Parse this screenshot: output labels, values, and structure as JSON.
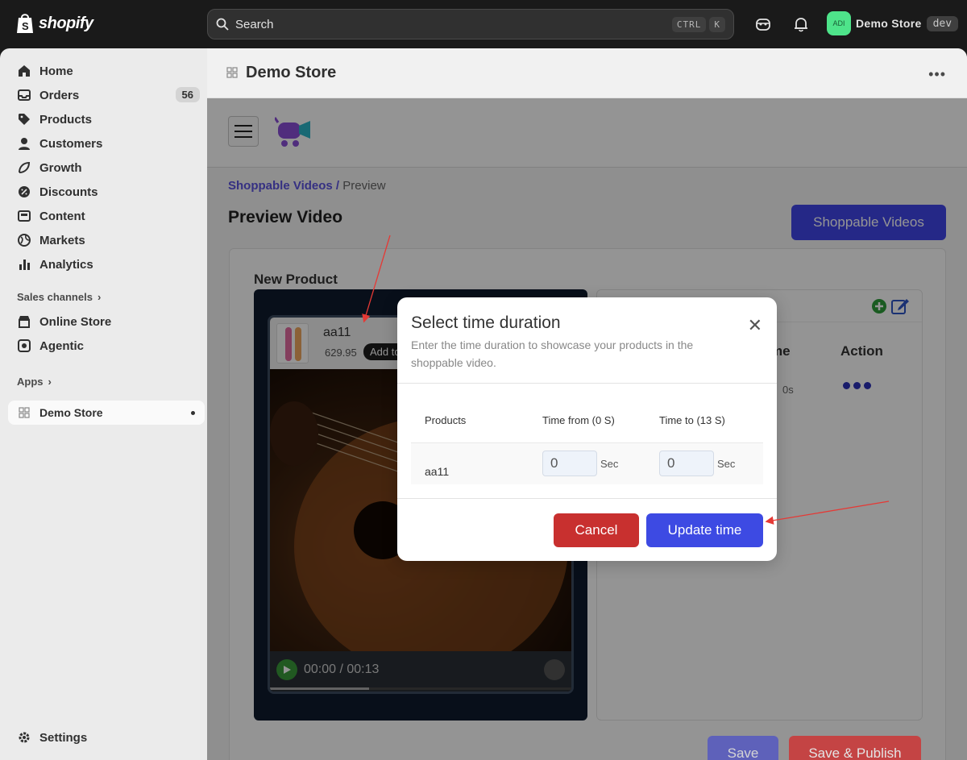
{
  "topbar": {
    "logo_text": "shopify",
    "search_placeholder": "Search",
    "shortcut_key1": "CTRL",
    "shortcut_key2": "K",
    "avatar_initials": "ADI",
    "store_name": "Demo Store",
    "env_badge": "dev"
  },
  "sidebar": {
    "items": [
      {
        "label": "Home",
        "icon": "home-icon"
      },
      {
        "label": "Orders",
        "icon": "inbox-icon",
        "count": "56"
      },
      {
        "label": "Products",
        "icon": "tag-icon"
      },
      {
        "label": "Customers",
        "icon": "person-icon"
      },
      {
        "label": "Growth",
        "icon": "growth-icon"
      },
      {
        "label": "Discounts",
        "icon": "discount-icon"
      },
      {
        "label": "Content",
        "icon": "content-icon"
      },
      {
        "label": "Markets",
        "icon": "globe-icon"
      },
      {
        "label": "Analytics",
        "icon": "bar-chart-icon"
      }
    ],
    "sales_channels_label": "Sales channels",
    "channels": [
      {
        "label": "Online Store",
        "icon": "store-icon"
      },
      {
        "label": "Agentic",
        "icon": "agentic-icon"
      }
    ],
    "apps_label": "Apps",
    "app_active": "Demo Store",
    "settings_label": "Settings"
  },
  "page": {
    "title": "Demo Store"
  },
  "app": {
    "breadcrumb_link": "Shoppable Videos /",
    "breadcrumb_current": "Preview",
    "heading": "Preview Video",
    "shoppable_button": "Shoppable Videos",
    "card_title": "New Product",
    "product_name": "aa11",
    "product_price": "629.95",
    "add_to_label": "Add to",
    "video_time": "00:00 / 00:13",
    "video_progress": 0.33,
    "table_col_time": "me",
    "table_col_action": "Action",
    "table_row_time": "0s",
    "save_label": "Save",
    "save_publish_label": "Save & Publish"
  },
  "modal": {
    "title": "Select time duration",
    "subtitle": "Enter the time duration to showcase your products in the shoppable video.",
    "col_products": "Products",
    "col_time_from": "Time from (0 S)",
    "col_time_to": "Time to (13 S)",
    "row_product": "aa11",
    "time_from_value": "0",
    "time_to_value": "0",
    "unit": "Sec",
    "cancel_label": "Cancel",
    "update_label": "Update time"
  },
  "colors": {
    "primary": "#3d4ae3",
    "danger": "#c8302f",
    "annotation": "#e53935"
  }
}
